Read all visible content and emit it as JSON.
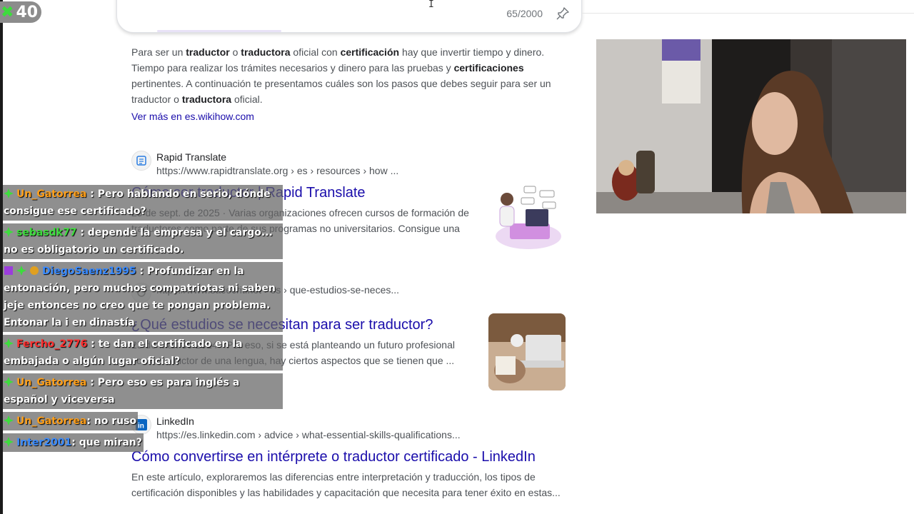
{
  "overlay_badge": {
    "count": "40"
  },
  "search": {
    "char_count": "65/2000"
  },
  "result_intro": {
    "segments": [
      {
        "t": "Para ser un ",
        "b": false
      },
      {
        "t": "traductor",
        "b": true
      },
      {
        "t": " o ",
        "b": false
      },
      {
        "t": "traductora",
        "b": true
      },
      {
        "t": " oficial con ",
        "b": false
      },
      {
        "t": "certificación",
        "b": true
      },
      {
        "t": " hay que invertir tiempo y dinero. Tiempo para realizar los trámites necesarios y dinero para las pruebas y ",
        "b": false
      },
      {
        "t": "certificaciones",
        "b": true
      },
      {
        "t": " pertinentes. A continuación te presentamos cuáles son los pasos que debes seguir para ser un traductor o ",
        "b": false
      },
      {
        "t": "traductora",
        "b": true
      },
      {
        "t": " oficial.",
        "b": false
      }
    ],
    "more_link": "Ver más en es.wikihow.com"
  },
  "results": [
    {
      "site": "Rapid Translate",
      "url": "https://www.rapidtranslate.org › es › resources › how ...",
      "title": "Cómo ser traductor | Rapid Translate",
      "desc": "25 de sept. de 2025 · Varias organizaciones ofrecen cursos de formación de traductores como parte de sus programas no universitarios. Consigue una ..."
    },
    {
      "site": "",
      "url": "https://www.sacecrit.net › es › que-estudios-se-neces...",
      "title": "¿Qué estudios se necesitan para ser traductor?",
      "desc": "25 de mar. de 2024 · Por eso, si se está planteando un futuro profesional como traductor de una lengua, hay ciertos aspectos que se tienen que ..."
    },
    {
      "site": "LinkedIn",
      "url": "https://es.linkedin.com › advice › what-essential-skills-qualifications...",
      "title": "Cómo convertirse en intérprete o traductor certificado - LinkedIn",
      "desc": "En este artículo, exploraremos las diferencias entre interpretación y traducción, los tipos de certificación disponibles y las habilidades y capacitación que necesita para tener éxito en estas..."
    }
  ],
  "chat": [
    {
      "user": "Un_Gatorrea",
      "color": "#ff9f1a",
      "badges": [
        "green"
      ],
      "text": ": Pero hablando en serio, dónde consigue ese certificado?"
    },
    {
      "user": "sebasdk77",
      "color": "#3ddc3d",
      "badges": [
        "green"
      ],
      "text": ": depende la empresa y el cargo... no es obligatorio un certificado."
    },
    {
      "user": "DiegoSaenz1995",
      "color": "#3a8bff",
      "badges": [
        "purple",
        "green",
        "gold"
      ],
      "text": ": Profundizar en la entonación, pero muchos compatriotas ni saben jeje entonces no creo que te pongan problema. Entonar la i en dinastía"
    },
    {
      "user": "Fercho_2776",
      "color": "#ff3030",
      "badges": [
        "green"
      ],
      "text": ": te dan el certificado en la embajada o algún lugar oficial?"
    },
    {
      "user": "Un_Gatorrea",
      "color": "#ff9f1a",
      "badges": [
        "green"
      ],
      "text": ": Pero eso es para inglés a español y viceversa"
    },
    {
      "user": "Un_Gatorrea",
      "color": "#ff9f1a",
      "badges": [
        "green"
      ],
      "text": ": no ruso"
    },
    {
      "user": "Inter2001",
      "color": "#3a8bff",
      "badges": [
        "green"
      ],
      "text": ": que miran?"
    }
  ],
  "colors": {
    "link": "#1a0dab",
    "accent_green": "#3ddc3d"
  }
}
